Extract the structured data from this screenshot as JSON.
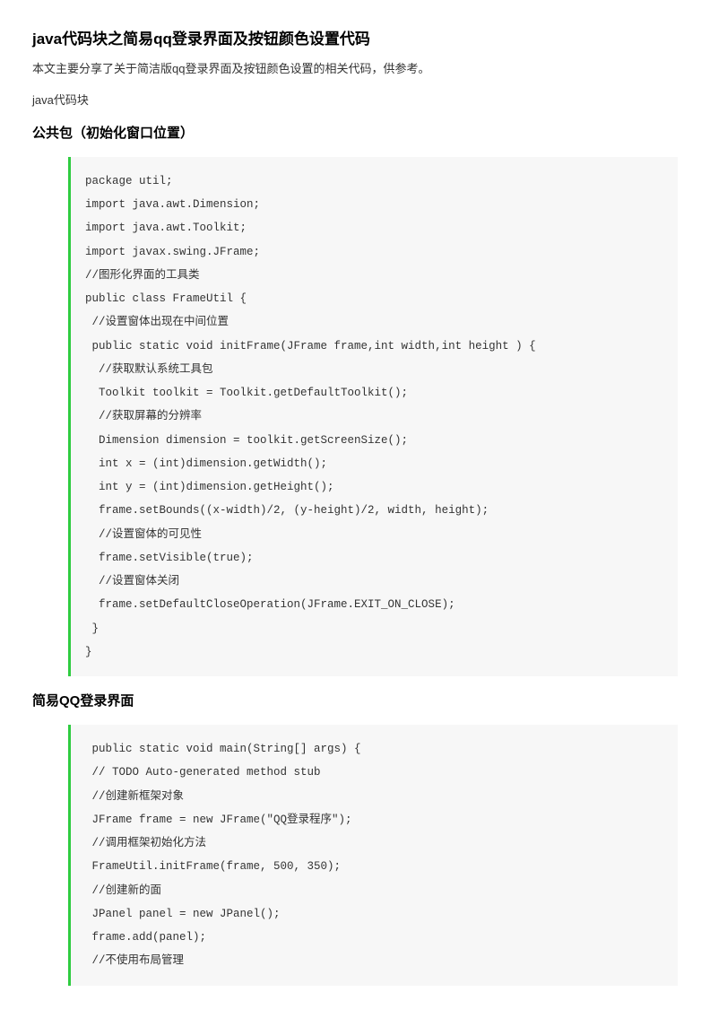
{
  "title": "java代码块之简易qq登录界面及按钮颜色设置代码",
  "intro": "本文主要分享了关于简洁版qq登录界面及按钮颜色设置的相关代码，供参考。",
  "label": "java代码块",
  "section1_title": "公共包（初始化窗口位置）",
  "code1": "package util;\nimport java.awt.Dimension;\nimport java.awt.Toolkit;\nimport javax.swing.JFrame;\n//图形化界面的工具类\npublic class FrameUtil {\n //设置窗体出现在中间位置\n public static void initFrame(JFrame frame,int width,int height ) {\n  //获取默认系统工具包\n  Toolkit toolkit = Toolkit.getDefaultToolkit();\n  //获取屏幕的分辨率\n  Dimension dimension = toolkit.getScreenSize();\n  int x = (int)dimension.getWidth();\n  int y = (int)dimension.getHeight();\n  frame.setBounds((x-width)/2, (y-height)/2, width, height);\n  //设置窗体的可见性\n  frame.setVisible(true);\n  //设置窗体关闭\n  frame.setDefaultCloseOperation(JFrame.EXIT_ON_CLOSE);\n }\n}",
  "section2_title": "简易QQ登录界面",
  "code2": " public static void main(String[] args) {\n // TODO Auto-generated method stub\n //创建新框架对象\n JFrame frame = new JFrame(\"QQ登录程序\");\n //调用框架初始化方法\n FrameUtil.initFrame(frame, 500, 350);\n //创建新的面\n JPanel panel = new JPanel();\n frame.add(panel);\n //不使用布局管理"
}
